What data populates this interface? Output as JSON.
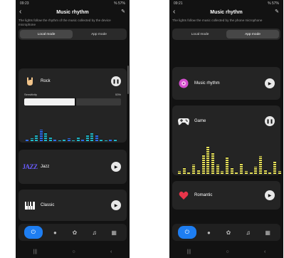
{
  "screen1": {
    "status": {
      "time": "09:23",
      "right": "% 57% "
    },
    "title": "Music rhythm",
    "subtitle": "The lights follow the rhythm of the music collected by the device microphone",
    "tabs": [
      {
        "label": "Local mode",
        "active": true
      },
      {
        "label": "App mode",
        "active": false
      }
    ],
    "rock": {
      "label": "Rock",
      "sensitivity_label": "Sensitivity",
      "sensitivity_value": "53%",
      "sensitivity": 0.53
    },
    "jazz": {
      "label": "Jazz",
      "icon_text": "JAZZ"
    },
    "classic": {
      "label": "Classic"
    }
  },
  "screen2": {
    "status": {
      "time": "09:21",
      "right": "% 57% "
    },
    "title": "Music rhythm",
    "subtitle": "The lights follow the music collected by the phone microphone",
    "tabs": [
      {
        "label": "Local mode",
        "active": false
      },
      {
        "label": "App mode",
        "active": true
      }
    ],
    "music_rhythm": {
      "label": "Music rhythm"
    },
    "game": {
      "label": "Game"
    },
    "romantic": {
      "label": "Romantic"
    }
  },
  "icons": [
    "back-icon",
    "edit-icon",
    "hand-rock-icon",
    "jazz-icon",
    "piano-icon",
    "disc-icon",
    "gamepad-icon",
    "heart-icon",
    "power-icon",
    "bulb-icon",
    "palette-icon",
    "music-note-icon",
    "grid-icon"
  ],
  "colors": {
    "background": "#121212",
    "card": "#242424",
    "accent": "#1e7ef2",
    "eq_cyan": "#1fb8c8",
    "eq_blue": "#2f6df0",
    "eq_yellow": "#e6e05a",
    "disc_pink": "#d44fd0",
    "heart_red": "#e8354a"
  }
}
